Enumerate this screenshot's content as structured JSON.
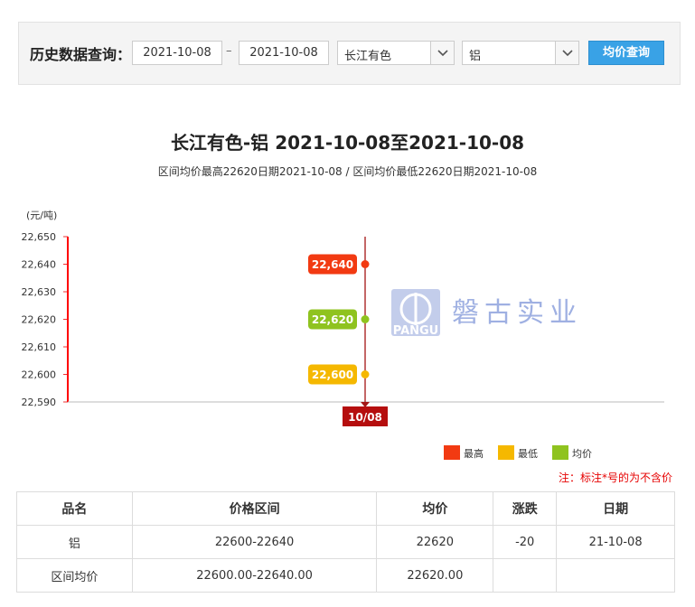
{
  "query": {
    "label": "历史数据查询：",
    "date_from": "2021-10-08",
    "date_separator": "–",
    "date_to": "2021-10-08",
    "market": "长江有色",
    "metal": "铝",
    "submit_label": "均价查询"
  },
  "chart_data": {
    "type": "line",
    "title": "长江有色-铝 2021-10-08至2021-10-08",
    "subtitle": "区间均价最高22620日期2021-10-08 / 区间均价最低22620日期2021-10-08",
    "ylabel": "(元/吨)",
    "ylim": [
      22590,
      22650
    ],
    "yticks": [
      "22,650",
      "22,640",
      "22,630",
      "22,620",
      "22,610",
      "22,600",
      "22,590"
    ],
    "ytick_values": [
      22650,
      22640,
      22630,
      22620,
      22610,
      22600,
      22590
    ],
    "categories": [
      "10/08"
    ],
    "series": [
      {
        "name": "最高",
        "values": [
          22640
        ],
        "labels": [
          "22,640"
        ],
        "color": "#f23a12"
      },
      {
        "name": "均价",
        "values": [
          22620
        ],
        "labels": [
          "22,620"
        ],
        "color": "#8fc31f"
      },
      {
        "name": "最低",
        "values": [
          22600
        ],
        "labels": [
          "22,600"
        ],
        "color": "#f5b800"
      }
    ],
    "legend": {
      "position": "bottom-right",
      "items": [
        {
          "name": "最高",
          "color": "#f23a12"
        },
        {
          "name": "最低",
          "color": "#f5b800"
        },
        {
          "name": "均价",
          "color": "#8fc31f"
        }
      ]
    },
    "watermark": {
      "logo_text": "PANGU",
      "company": "磐古实业"
    },
    "grid": false
  },
  "note": "注：标注*号的为不含价",
  "table": {
    "headers": [
      "品名",
      "价格区间",
      "均价",
      "涨跌",
      "日期"
    ],
    "rows": [
      [
        "铝",
        "22600-22640",
        "22620",
        "-20",
        "21-10-08"
      ],
      [
        "区间均价",
        "22600.00-22640.00",
        "22620.00",
        "",
        ""
      ]
    ]
  }
}
